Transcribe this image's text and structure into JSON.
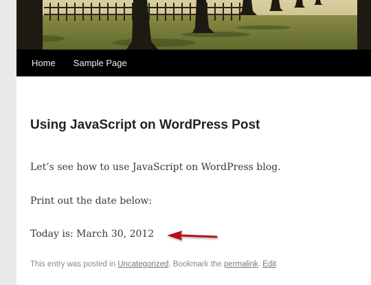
{
  "nav": {
    "items": [
      {
        "label": "Home"
      },
      {
        "label": "Sample Page"
      }
    ]
  },
  "post": {
    "title": "Using JavaScript on WordPress Post",
    "paragraphs": [
      "Let’s see how to use JavaScript on WordPress blog.",
      "Print out the date below:",
      "Today is: March 30, 2012"
    ],
    "meta": {
      "prefix": "This entry was posted in ",
      "category": "Uncategorized",
      "middle": ". Bookmark the ",
      "permalink": "permalink",
      "separator": ". ",
      "edit": "Edit"
    }
  },
  "colors": {
    "nav_bg": "#000000",
    "arrow": "#b80f14",
    "title": "#222222"
  }
}
